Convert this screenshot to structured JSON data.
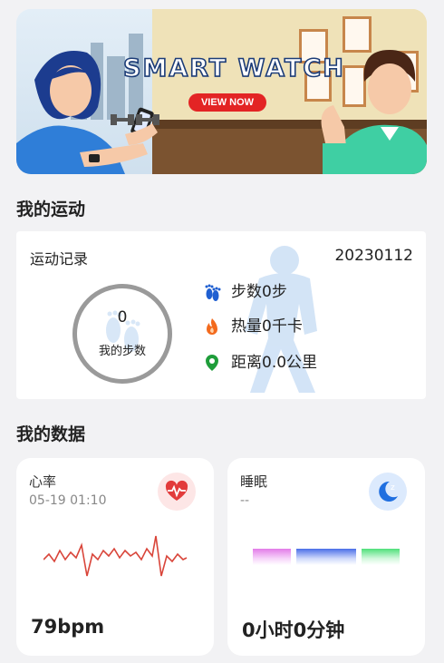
{
  "banner": {
    "title": "SMART WATCH",
    "button_label": "VIEW NOW",
    "page_count": 3,
    "active_page": 2
  },
  "sections": {
    "sport_heading": "我的运动",
    "data_heading": "我的数据"
  },
  "activity": {
    "title": "运动记录",
    "date": "20230112",
    "steps_value": "0",
    "steps_label": "我的步数",
    "stats": [
      {
        "icon": "footprints-icon",
        "text": "步数0步",
        "color": "#1f5fd1"
      },
      {
        "icon": "flame-icon",
        "text": "热量0千卡",
        "color": "#f36a1d"
      },
      {
        "icon": "location-pin-icon",
        "text": "距离0.0公里",
        "color": "#1f9d3a"
      }
    ]
  },
  "heart_rate": {
    "title": "心率",
    "timestamp": "05-19 01:10",
    "value": "79bpm",
    "icon": "heart-pulse-icon",
    "accent": "#e23b3b"
  },
  "sleep": {
    "title": "睡眠",
    "subtitle": "--",
    "value": "0小时0分钟",
    "icon": "moon-icon",
    "accent": "#1f6fe0",
    "bar_colors": [
      "#e27ce8",
      "#4a6ee8",
      "#4fe07a"
    ]
  }
}
